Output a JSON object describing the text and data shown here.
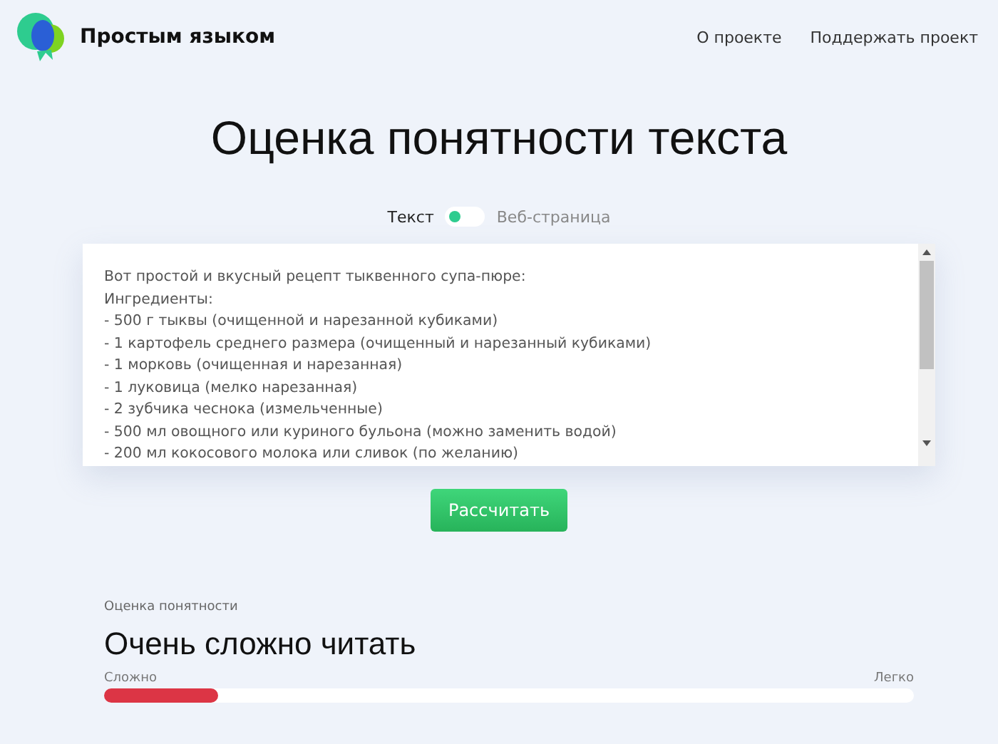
{
  "header": {
    "brand": "Простым языком",
    "nav": [
      "О проекте",
      "Поддержать проект"
    ]
  },
  "title": "Оценка понятности текста",
  "mode_switch": {
    "options": [
      {
        "label": "Текст",
        "selected": true
      },
      {
        "label": "Веб-страница",
        "selected": false
      }
    ]
  },
  "text_input": {
    "lines": [
      "Вот простой и вкусный рецепт тыквенного супа-пюре:",
      "Ингредиенты:",
      "- 500 г тыквы (очищенной и нарезанной кубиками)",
      "- 1 картофель среднего размера (очищенный и нарезанный кубиками)",
      "- 1 морковь (очищенная и нарезанная)",
      "- 1 луковица (мелко нарезанная)",
      "- 2 зубчика чеснока (измельченные)",
      "- 500 мл овощного или куриного бульона (можно заменить водой)",
      "- 200 мл кокосового молока или сливок (по желанию)"
    ]
  },
  "calculate_button": "Рассчитать",
  "result": {
    "label": "Оценка понятности",
    "verdict": "Очень сложно читать",
    "scale_min": "Сложно",
    "scale_max": "Легко",
    "level": 0.14
  }
}
